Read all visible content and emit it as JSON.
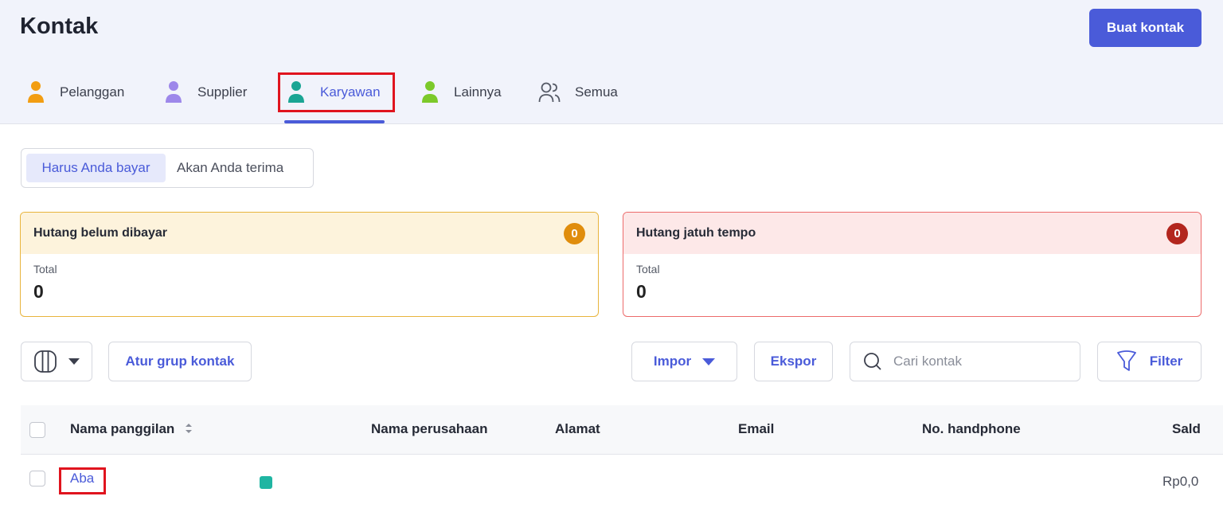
{
  "header": {
    "title": "Kontak",
    "create_button": "Buat kontak"
  },
  "tabs": [
    {
      "label": "Pelanggan",
      "icon": "person-icon",
      "color": "#f29d12"
    },
    {
      "label": "Supplier",
      "icon": "person-icon",
      "color": "#9d87ea"
    },
    {
      "label": "Karyawan",
      "icon": "person-icon",
      "color": "#1aa594",
      "active": true
    },
    {
      "label": "Lainnya",
      "icon": "person-icon",
      "color": "#7cc92a"
    },
    {
      "label": "Semua",
      "icon": "people-icon",
      "color": "#555a66"
    }
  ],
  "segment": {
    "option_a": "Harus Anda bayar",
    "option_b": "Akan Anda terima",
    "selected": "Harus Anda bayar"
  },
  "cards": {
    "unpaid": {
      "title": "Hutang belum dibayar",
      "badge": "0",
      "total_label": "Total",
      "total_value": "0",
      "color": "#e08d0c"
    },
    "overdue": {
      "title": "Hutang jatuh tempo",
      "badge": "0",
      "total_label": "Total",
      "total_value": "0",
      "color": "#b3261e"
    }
  },
  "toolbar": {
    "group_button": "Atur grup kontak",
    "import_button": "Impor",
    "export_button": "Ekspor",
    "search_placeholder": "Cari kontak",
    "filter_button": "Filter"
  },
  "table": {
    "columns": [
      "Nama panggilan",
      "Nama perusahaan",
      "Alamat",
      "Email",
      "No. handphone",
      "Sald"
    ],
    "rows": [
      {
        "name": "Aba",
        "saldo": "Rp0,0"
      }
    ]
  },
  "colors": {
    "accent": "#4a5bd9",
    "highlight": "#e0141e"
  }
}
